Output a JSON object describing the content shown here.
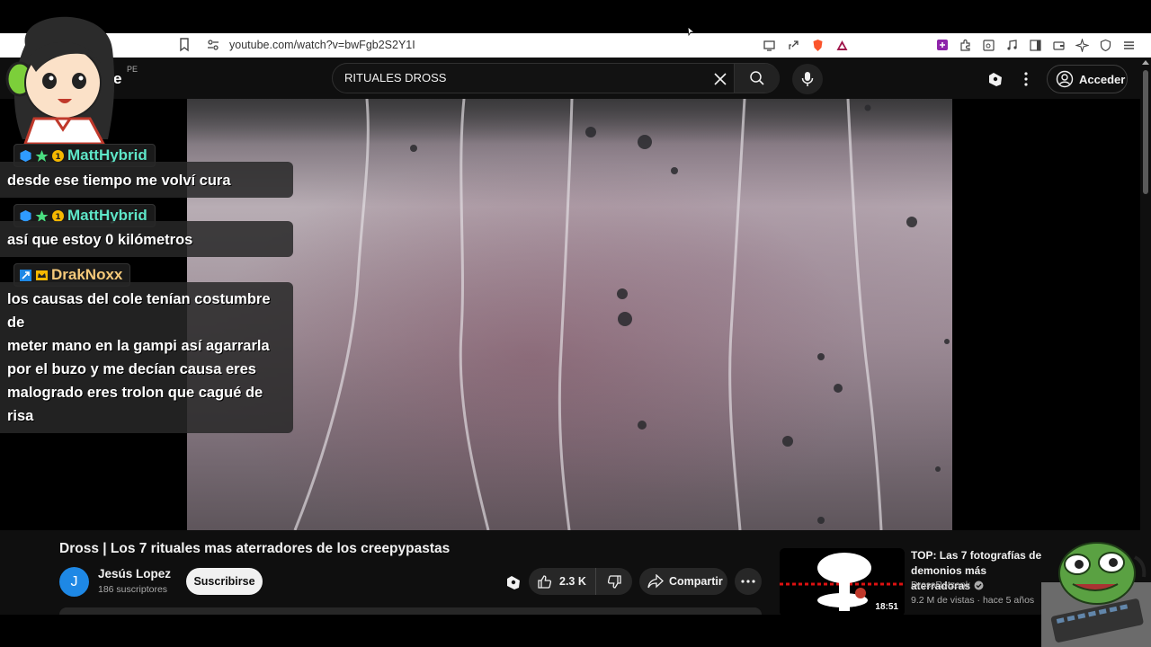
{
  "browser": {
    "url": "youtube.com/watch?v=bwFgb2S2Y1I"
  },
  "header": {
    "logo_fragment": "e",
    "region": "PE",
    "search_value": "RITUALES DROSS",
    "signin_label": "Acceder"
  },
  "chat": {
    "messages": [
      {
        "user": "MattHybrid",
        "user_color": "#5ee6c8",
        "text": "desde ese tiempo me volví cura"
      },
      {
        "user": "MattHybrid",
        "user_color": "#5ee6c8",
        "text": "así que estoy 0 kilómetros"
      },
      {
        "user": "DrakNoxx",
        "user_color": "#f5c97a",
        "text_lines": [
          "los causas del cole tenían costumbre de",
          "meter mano en la gampi así agarrarla",
          "por el buzo y me decían causa eres",
          "malogrado eres trolon que cagué de risa"
        ]
      }
    ]
  },
  "video": {
    "title": "Dross | Los 7 rituales mas aterradores de los creepypastas",
    "channel_initial": "J",
    "channel_name": "Jesús Lopez",
    "subscribers": "186 suscriptores",
    "subscribe_label": "Suscribirse",
    "likes": "2.3 K",
    "share_label": "Compartir"
  },
  "recommendation": {
    "title_line1": "TOP: Las 7 fotografías de",
    "title_line2": "demonios más aterradoras",
    "channel": "DrossRotzank",
    "meta": "9.2 M de vistas · hace 5 años",
    "duration": "18:51"
  },
  "colors": {
    "accent_blue": "#1e88e5",
    "bg_dark": "#0f0f0f"
  }
}
